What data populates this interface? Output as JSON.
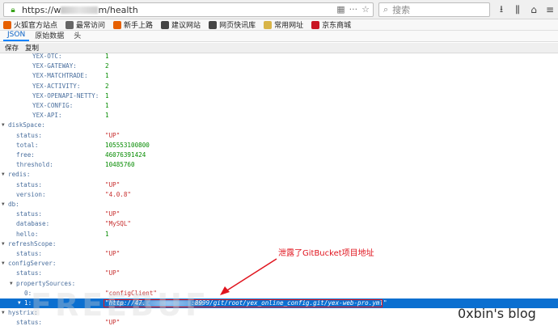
{
  "browser": {
    "url_prefix": "https://w",
    "url_suffix": "m/health",
    "search_placeholder": "搜索"
  },
  "bookmarks": [
    {
      "label": "火狐官方站点",
      "icon": "firefox-icon",
      "color": "#e66000"
    },
    {
      "label": "最常访问",
      "icon": "gear-icon",
      "color": "#666666"
    },
    {
      "label": "新手上路",
      "icon": "firefox-icon",
      "color": "#e66000"
    },
    {
      "label": "建议网站",
      "icon": "globe-icon",
      "color": "#444444"
    },
    {
      "label": "网页快讯库",
      "icon": "globe-icon",
      "color": "#444444"
    },
    {
      "label": "常用网址",
      "icon": "folder-icon",
      "color": "#d8b447"
    },
    {
      "label": "京东商城",
      "icon": "jd-icon",
      "color": "#c91623"
    }
  ],
  "viewer": {
    "tabs": [
      "JSON",
      "原始数据",
      "头"
    ],
    "actions": [
      "保存",
      "复制"
    ]
  },
  "tree": [
    {
      "key": "YEX-OTC:",
      "value": "1",
      "type": "num",
      "indent": 40
    },
    {
      "key": "YEX-GATEWAY:",
      "value": "2",
      "type": "num",
      "indent": 40
    },
    {
      "key": "YEX-MATCHTRADE:",
      "value": "1",
      "type": "num",
      "indent": 40
    },
    {
      "key": "YEX-ACTIVITY:",
      "value": "2",
      "type": "num",
      "indent": 40
    },
    {
      "key": "YEX-OPENAPI-NETTY:",
      "value": "1",
      "type": "num",
      "indent": 40
    },
    {
      "key": "YEX-CONFIG:",
      "value": "1",
      "type": "num",
      "indent": 40
    },
    {
      "key": "YEX-API:",
      "value": "1",
      "type": "num",
      "indent": 40
    },
    {
      "key": "diskSpace:",
      "value": "",
      "type": "obj",
      "indent": 10
    },
    {
      "key": "status:",
      "value": "\"UP\"",
      "type": "str",
      "indent": 20
    },
    {
      "key": "total:",
      "value": "105553100800",
      "type": "num",
      "indent": 20
    },
    {
      "key": "free:",
      "value": "46076391424",
      "type": "num",
      "indent": 20
    },
    {
      "key": "threshold:",
      "value": "10485760",
      "type": "num",
      "indent": 20
    },
    {
      "key": "redis:",
      "value": "",
      "type": "obj",
      "indent": 10
    },
    {
      "key": "status:",
      "value": "\"UP\"",
      "type": "str",
      "indent": 20
    },
    {
      "key": "version:",
      "value": "\"4.0.8\"",
      "type": "str",
      "indent": 20
    },
    {
      "key": "db:",
      "value": "",
      "type": "obj",
      "indent": 10
    },
    {
      "key": "status:",
      "value": "\"UP\"",
      "type": "str",
      "indent": 20
    },
    {
      "key": "database:",
      "value": "\"MySQL\"",
      "type": "str",
      "indent": 20
    },
    {
      "key": "hello:",
      "value": "1",
      "type": "num",
      "indent": 20
    },
    {
      "key": "refreshScope:",
      "value": "",
      "type": "obj",
      "indent": 10
    },
    {
      "key": "status:",
      "value": "\"UP\"",
      "type": "str",
      "indent": 20
    },
    {
      "key": "configServer:",
      "value": "",
      "type": "obj",
      "indent": 10
    },
    {
      "key": "status:",
      "value": "\"UP\"",
      "type": "str",
      "indent": 20
    },
    {
      "key": "propertySources:",
      "value": "",
      "type": "obj",
      "indent": 20
    },
    {
      "key": "0:",
      "value": "\"configClient\"",
      "type": "str",
      "indent": 30
    },
    {
      "key": "1:",
      "value_prefix": "\"http://47.",
      "value_suffix": ":8999/git/root/yex_online_config.git/yex-web-pro.yml\"",
      "type": "selected",
      "indent": 30
    },
    {
      "key": "hystrix:",
      "value": "",
      "type": "obj",
      "indent": 10
    },
    {
      "key": "status:",
      "value": "\"UP\"",
      "type": "str",
      "indent": 20
    }
  ],
  "annotation": "泄露了GitBucket项目地址",
  "watermark": "0xbin's blog",
  "ghost_text": "FREEBUF"
}
